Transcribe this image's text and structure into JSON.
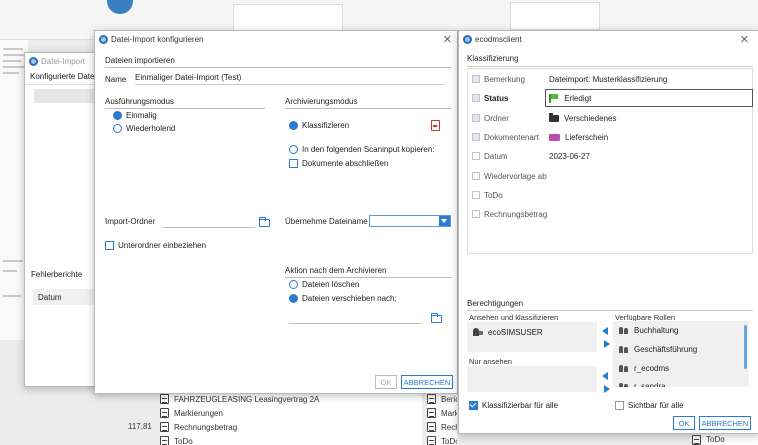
{
  "background": {
    "list_left": [
      {
        "label": "FAHRZEUGLEASING Leasingvertrag 2A",
        "icon": "document-icon"
      },
      {
        "label": "Markierungen",
        "icon": "document-icon"
      },
      {
        "label": "Rechnungsbetrag",
        "icon": "document-icon"
      },
      {
        "label": "ToDo",
        "icon": "document-icon"
      }
    ],
    "amount": "117,81",
    "list_right": [
      {
        "label": "Beric",
        "icon": "document-icon"
      },
      {
        "label": "Mark",
        "icon": "document-icon"
      },
      {
        "label": "Rech",
        "icon": "document-icon"
      },
      {
        "label": "ToDo",
        "icon": "document-icon"
      }
    ],
    "list_far_right": [
      {
        "label": "ToDo",
        "icon": "document-icon"
      }
    ]
  },
  "import_dialog": {
    "title": "Datei-Import",
    "configured_header": "Konfigurierte Datei-Imp",
    "errors_label": "Fehlerberichte",
    "date_column": "Datum"
  },
  "config_dialog": {
    "title": "Datei-Import konfigurieren",
    "section_title": "Dateien importieren",
    "name_label": "Name",
    "name_value": "Einmaliger Datei-Import (Test)",
    "execution_mode": {
      "label": "Ausführungsmodus",
      "options": [
        {
          "label": "Einmalig",
          "selected": true
        },
        {
          "label": "Wiederholend",
          "selected": false
        }
      ]
    },
    "archive_mode": {
      "label": "Archivierungsmodus",
      "classify": "Klassifizieren",
      "copy_scaninput": "In den folgenden Scaninput kopieren:",
      "close_documents": "Dokumente abschließen"
    },
    "import_folder_label": "Import-Ordner",
    "include_subfolders": "Unterordner einbeziehen",
    "take_filename_label": "Übernehme Dateiname in",
    "after_archive": {
      "label": "Aktion nach dem Archivieren",
      "options": [
        {
          "label": "Dateien löschen",
          "selected": false
        },
        {
          "label": "Dateien verschieben nach:",
          "selected": true
        }
      ]
    },
    "ok_label": "OK",
    "cancel_label": "ABBRECHEN"
  },
  "client_dialog": {
    "title": "ecodmsclient",
    "classification_header": "Klassifizierung",
    "fields": [
      {
        "label": "Bemerkung",
        "value": "Dateimport: Musterklassifizierung",
        "icon": "",
        "checked": true,
        "bold": false
      },
      {
        "label": "Status",
        "value": "Erledigt",
        "icon": "flag",
        "checked": true,
        "bold": true
      },
      {
        "label": "Ordner",
        "value": "Verschiedenes",
        "icon": "folder",
        "checked": true,
        "bold": false
      },
      {
        "label": "Dokumentenart",
        "value": "Lieferschein",
        "icon": "truck",
        "checked": true,
        "bold": false
      },
      {
        "label": "Datum",
        "value": "2023-06-27",
        "icon": "",
        "checked": false,
        "bold": false
      },
      {
        "label": "Wiedervorlage ab",
        "value": "",
        "icon": "",
        "checked": false,
        "bold": false
      },
      {
        "label": "ToDo",
        "value": "",
        "icon": "",
        "checked": false,
        "bold": false
      },
      {
        "label": "Rechnungsbetrag",
        "value": "",
        "icon": "",
        "checked": false,
        "bold": false
      }
    ],
    "permissions": {
      "header": "Berechtigungen",
      "view_classify_label": "Ansehen und klassifizieren",
      "view_only_label": "Nur ansehen",
      "available_roles_label": "Verfügbare Rollen",
      "view_classify_users": [
        "ecoSIMSUSER"
      ],
      "available_roles": [
        "Buchhaltung",
        "Geschäftsführung",
        "r_ecodms",
        "r_sandra"
      ],
      "classifiable_all": "Klassifizierbar für alle",
      "visible_all": "Sichtbar für alle"
    },
    "ok_label": "OK",
    "cancel_label": "ABBRECHEN"
  },
  "colors": {
    "accent": "#2a7ad0",
    "pdf_red": "#d9302c",
    "status_green": "#55b83e",
    "doctype_purple": "#b84fb0"
  }
}
